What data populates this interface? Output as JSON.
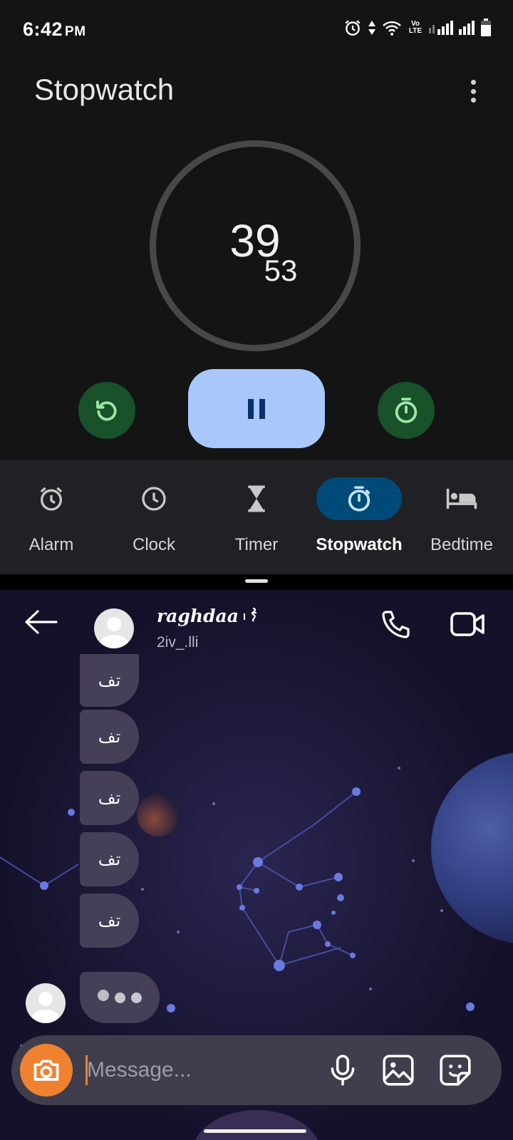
{
  "status_bar": {
    "time": "6:42",
    "ampm": "PM",
    "volte_line1": "Vo",
    "volte_line2": "LTE"
  },
  "clock_app": {
    "title": "Stopwatch",
    "stopwatch": {
      "seconds": "39",
      "hundredths": "53"
    },
    "nav": [
      {
        "label": "Alarm",
        "icon": "alarm-icon",
        "active": false
      },
      {
        "label": "Clock",
        "icon": "clock-icon",
        "active": false
      },
      {
        "label": "Timer",
        "icon": "hourglass-icon",
        "active": false
      },
      {
        "label": "Stopwatch",
        "icon": "stopwatch-icon",
        "active": true
      },
      {
        "label": "Bedtime",
        "icon": "bed-icon",
        "active": false
      }
    ]
  },
  "chat": {
    "contact_name": "raghdaa",
    "contact_handle": "2iv_.lli",
    "messages": [
      "تف",
      "تف",
      "تف",
      "تف",
      "تف"
    ],
    "composer": {
      "placeholder": "Message..."
    }
  },
  "colors": {
    "accent_green": "#18512a",
    "pause_button": "#a8c7fa",
    "active_tab": "#004a77",
    "camera_button": "#f0812f"
  }
}
